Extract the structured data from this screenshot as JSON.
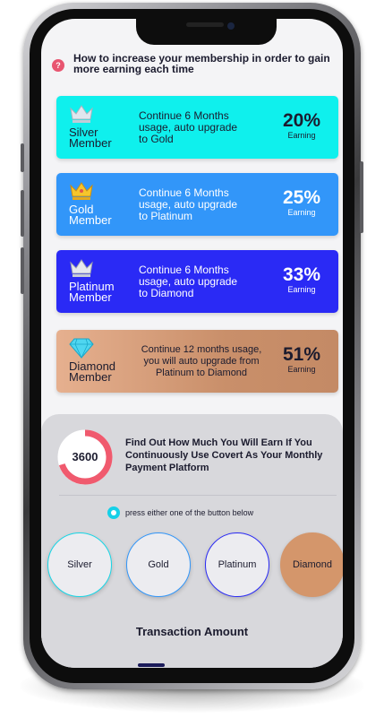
{
  "help": {
    "icon": "question-icon",
    "icon_glyph": "?",
    "text": "How to increase your membership in order to gain more earning each time"
  },
  "tiers": {
    "silver": {
      "name": "Silver",
      "suffix": "Member",
      "description": "Continue 6 Months usage, auto upgrade to Gold",
      "rate": "20%",
      "rate_label": "Earning",
      "color": "#0ff0ed"
    },
    "gold": {
      "name": "Gold",
      "suffix": "Member",
      "description": "Continue 6 Months usage, auto upgrade to Platinum",
      "rate": "25%",
      "rate_label": "Earning",
      "color": "#3296f9"
    },
    "platinum": {
      "name": "Platinum",
      "suffix": "Member",
      "description": "Continue 6 Months usage, auto upgrade to Diamond",
      "rate": "33%",
      "rate_label": "Earning",
      "color": "#2a2af5"
    },
    "diamond": {
      "name": "Diamond",
      "suffix": "Member",
      "description": "Continue 12 months usage, you will auto upgrade from Platinum to Diamond",
      "rate": "51%",
      "rate_label": "Earning",
      "color": "#d4966b"
    }
  },
  "calculator": {
    "value": "3600",
    "progress": 0.7,
    "ring_color": "#f05a6e",
    "promo_text": "Find Out How Much You Will Earn If You Continuously Use Covert As Your Monthly Payment Platform",
    "hint_text": "press either one of the button below",
    "buttons": {
      "silver": "Silver",
      "gold": "Gold",
      "platinum": "Platinum",
      "diamond": "Diamond"
    },
    "transaction_title": "Transaction Amount"
  }
}
